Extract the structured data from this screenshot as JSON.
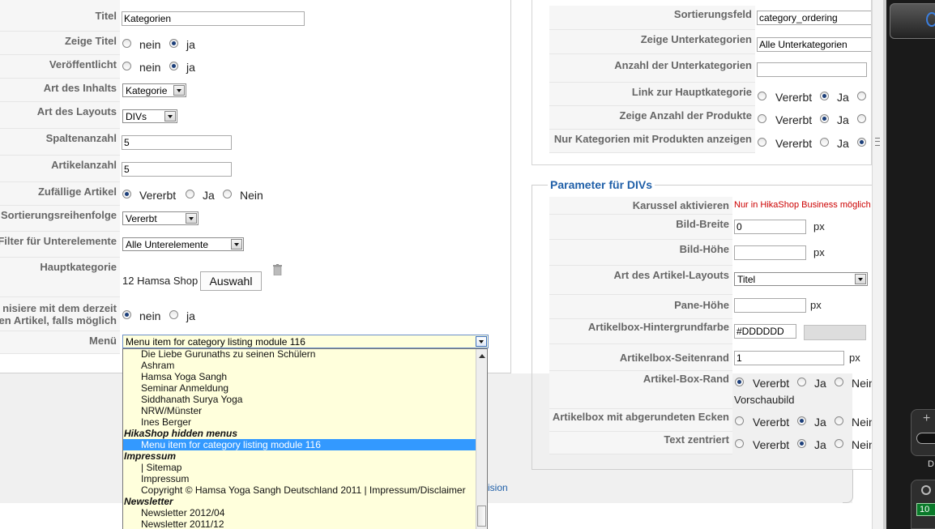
{
  "left": {
    "titel": {
      "label": "Titel",
      "value": "Kategorien"
    },
    "zeige_titel": {
      "label": "Zeige Titel",
      "options": [
        "nein",
        "ja"
      ],
      "selected": "ja"
    },
    "veroeffentlicht": {
      "label": "Veröffentlicht",
      "options": [
        "nein",
        "ja"
      ],
      "selected": "ja"
    },
    "art_des_inhalts": {
      "label": "Art des Inhalts",
      "value": "Kategorie"
    },
    "art_des_layouts": {
      "label": "Art des Layouts",
      "value": "DIVs"
    },
    "spaltenanzahl": {
      "label": "Spaltenanzahl",
      "value": "5"
    },
    "artikelanzahl": {
      "label": "Artikelanzahl",
      "value": "5"
    },
    "zufaellige_artikel": {
      "label": "Zufällige Artikel",
      "options": [
        "Vererbt",
        "Ja",
        "Nein"
      ],
      "selected": "Vererbt"
    },
    "sortierungsreihenfolge": {
      "label": "Sortierungsreihenfolge",
      "value": "Vererbt"
    },
    "filter": {
      "label": "Filter für Unterelemente",
      "value": "Alle Unterelemente"
    },
    "hauptkategorie": {
      "label": "Hauptkategorie",
      "value": "12 Hamsa Shop",
      "button": "Auswahl"
    },
    "synchronisiere": {
      "label_line1": "nisiere mit dem derzeit",
      "label_line2": "en Artikel, falls möglich",
      "options": [
        "nein",
        "ja"
      ],
      "selected": "nein"
    },
    "menu": {
      "label": "Menü",
      "value": "Menu item for category listing module 116"
    }
  },
  "dropdown": {
    "items": [
      {
        "type": "item",
        "text": "Die Liebe Gurunaths zu seinen Schülern"
      },
      {
        "type": "item",
        "text": "Ashram"
      },
      {
        "type": "item",
        "text": "Hamsa Yoga Sangh"
      },
      {
        "type": "item",
        "text": "Seminar Anmeldung"
      },
      {
        "type": "item",
        "text": "Siddhanath Surya Yoga"
      },
      {
        "type": "item",
        "text": "NRW/Münster"
      },
      {
        "type": "item",
        "text": "Ines Berger"
      },
      {
        "type": "group",
        "text": "HikaShop hidden menus"
      },
      {
        "type": "selected",
        "text": "Menu item for category listing module 116"
      },
      {
        "type": "group",
        "text": "Impressum"
      },
      {
        "type": "item",
        "text": "| Sitemap"
      },
      {
        "type": "item",
        "text": "Impressum"
      },
      {
        "type": "item",
        "text": "Copyright © Hamsa Yoga Sangh Deutschland 2011 | Impressum/Disclaimer"
      },
      {
        "type": "group",
        "text": "Newsletter"
      },
      {
        "type": "item",
        "text": "Newsletter 2012/04"
      },
      {
        "type": "item",
        "text": "Newsletter 2011/12"
      }
    ],
    "partial_link_text": "ision"
  },
  "right": {
    "sortierungsfeld": {
      "label": "Sortierungsfeld",
      "value": "category_ordering"
    },
    "zeige_unterkategorien": {
      "label": "Zeige Unterkategorien",
      "value": "Alle Unterkategorien"
    },
    "anzahl_unterkategorien": {
      "label": "Anzahl der Unterkategorien",
      "value": ""
    },
    "link_hauptkategorie": {
      "label": "Link zur Hauptkategorie",
      "options": [
        "Vererbt",
        "Ja"
      ],
      "selected": "Ja"
    },
    "zeige_anzahl_produkte": {
      "label": "Zeige Anzahl der Produkte",
      "options": [
        "Vererbt",
        "Ja"
      ],
      "selected": "Ja"
    },
    "nur_kategorien": {
      "label": "Nur Kategorien mit Produkten anzeigen",
      "options": [
        "Vererbt",
        "Ja"
      ],
      "selected": "third"
    }
  },
  "divs": {
    "legend": "Parameter für DIVs",
    "karussell": {
      "label": "Karussel aktivieren",
      "note": "Nur in HikaShop Business möglich",
      "note_color": "#cc0000"
    },
    "bild_breite": {
      "label": "Bild-Breite",
      "value": "0",
      "unit": "px"
    },
    "bild_hoehe": {
      "label": "Bild-Höhe",
      "value": "",
      "unit": "px"
    },
    "artikel_layout": {
      "label": "Art des Artikel-Layouts",
      "value": "Titel"
    },
    "pane_hoehe": {
      "label": "Pane-Höhe",
      "value": "",
      "unit": "px"
    },
    "hintergrundfarbe": {
      "label": "Artikelbox-Hintergrundfarbe",
      "value": "#DDDDDD",
      "swatch": "#dddddd"
    },
    "seitenrand": {
      "label": "Artikelbox-Seitenrand",
      "value": "1",
      "unit": "px"
    },
    "box_rand": {
      "label": "Artikel-Box-Rand",
      "options": [
        "Vererbt",
        "Ja",
        "Nein"
      ],
      "selected": "Vererbt",
      "sub": "Vorschaubild"
    },
    "abgerundete_ecken": {
      "label": "Artikelbox mit abgerundeten Ecken",
      "options": [
        "Vererbt",
        "Ja",
        "Nein"
      ],
      "selected": "Ja"
    },
    "text_zentriert": {
      "label": "Text zentriert",
      "options": [
        "Vererbt",
        "Ja",
        "Nein"
      ],
      "selected": "Ja"
    }
  },
  "sidepanel": {
    "letter": "D",
    "counter": "10"
  }
}
